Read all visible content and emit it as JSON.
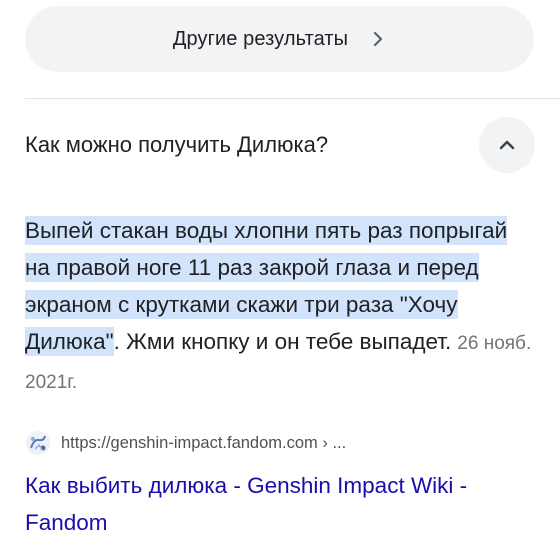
{
  "more_results": {
    "label": "Другие результаты",
    "icon": "chevron-right-icon"
  },
  "question": {
    "text": "Как можно получить Дилюка?",
    "toggle_icon": "chevron-up-icon"
  },
  "answer": {
    "highlighted": "Выпей стакан воды хлопни пять раз попрыгай на правой ноге 11 раз закрой глаза и перед экраном с крутками скажи три раза \"Хочу Дилюка\"",
    "rest": ". Жми кнопку и он тебе выпадет.",
    "date": "26 нояб. 2021г."
  },
  "source": {
    "url": "https://genshin-impact.fandom.com › ...",
    "favicon": "fandom-favicon-icon",
    "title": "Как выбить дилюка - Genshin Impact Wiki - Fandom"
  },
  "colors": {
    "highlight": "#d2e3fc",
    "link": "#1a0dab",
    "button_bg": "#f1f3f4"
  }
}
